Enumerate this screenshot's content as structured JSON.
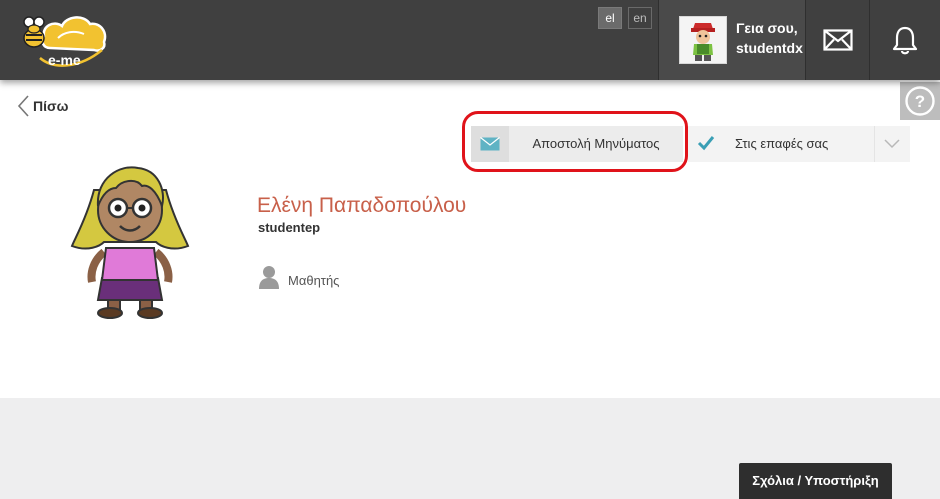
{
  "header": {
    "logo_text": "e-me",
    "languages": [
      "el",
      "en"
    ],
    "active_language": "el",
    "greeting_line1": "Γεια σου,",
    "greeting_line2": "studentdx"
  },
  "nav": {
    "back_label": "Πίσω",
    "help_label": "?"
  },
  "actions": {
    "send_message_label": "Αποστολή Μηνύματος",
    "contacts_label": "Στις επαφές σας"
  },
  "profile": {
    "name": "Ελένη Παπαδοπούλου",
    "username": "studentep",
    "role": "Μαθητής"
  },
  "footer": {
    "support_label": "Σχόλια / Υποστήριξη"
  },
  "colors": {
    "topbar": "#404040",
    "accent_name": "#c8604a",
    "check": "#3a9fb5",
    "highlight": "#e0131a",
    "logo_yellow": "#f2c230"
  }
}
